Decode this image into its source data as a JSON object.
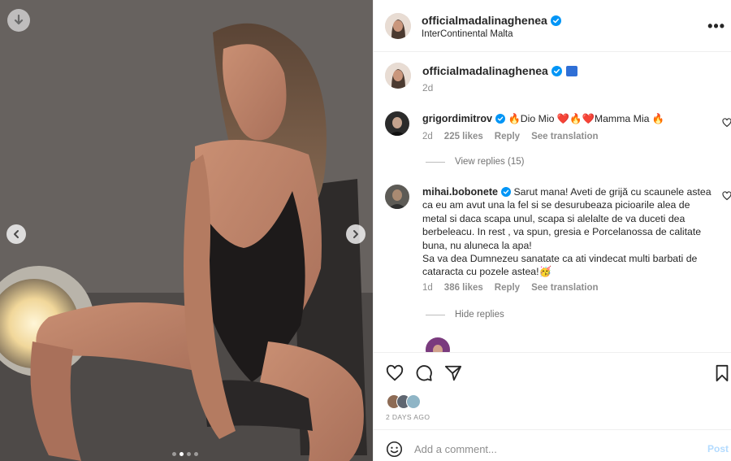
{
  "post": {
    "author": "officialmadalinaghenea",
    "location": "InterContinental Malta",
    "caption_time": "2d",
    "more_label": "•••"
  },
  "comments": [
    {
      "user": "grigordimitrov",
      "text": "🔥Dio Mio ❤️🔥❤️Mamma Mia 🔥",
      "time": "2d",
      "likes": "225 likes",
      "reply": "Reply",
      "translate": "See translation",
      "replies_label": "View replies (15)"
    },
    {
      "user": "mihai.bobonete",
      "text": "Sarut mana! Aveti de grijă cu scaunele astea ca eu am avut una la fel si se desurubeaza picioarile alea de metal si daca scapa unul, scapa si alelalte de va duceti dea berbeleacu. In rest , va spun, gresia e Porcelanossa de calitate buna, nu aluneca la apa!",
      "text2": "Sa va dea Dumnezeu sanatate ca ati vindecat multi barbati de cataracta cu pozele astea!🥳",
      "time": "1d",
      "likes": "386 likes",
      "reply": "Reply",
      "translate": "See translation",
      "replies_label": "Hide replies"
    }
  ],
  "footer": {
    "date": "2 DAYS AGO",
    "comment_placeholder": "Add a comment...",
    "post_label": "Post"
  },
  "carousel": {
    "slides": 4,
    "active_index": 1
  },
  "colors": {
    "verified": "#0095f6",
    "text": "#262626",
    "muted": "#8e8e8e",
    "post_disabled": "#b3dbff"
  }
}
